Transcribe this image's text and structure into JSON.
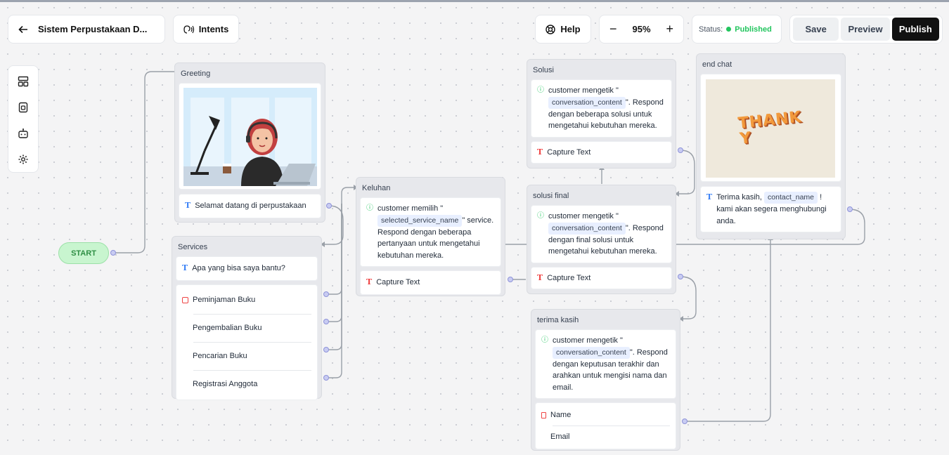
{
  "toolbar": {
    "back_icon": "arrow-left-icon",
    "project_title": "Sistem Perpustakaan D...",
    "intents_label": "Intents",
    "help_label": "Help",
    "zoom_out": "−",
    "zoom_level": "95%",
    "zoom_in": "+",
    "status_label": "Status:",
    "status_value": "Published",
    "save_label": "Save",
    "preview_label": "Preview",
    "publish_label": "Publish"
  },
  "sidebar": {
    "items": [
      {
        "icon": "layout-icon"
      },
      {
        "icon": "document-icon"
      },
      {
        "icon": "bot-icon"
      },
      {
        "icon": "gear-icon"
      }
    ]
  },
  "colors": {
    "status_green": "#22c55e",
    "publish_bg": "#111111",
    "wire": "#9aa0a8",
    "port": "#8e93d9"
  },
  "start": {
    "label": "START"
  },
  "nodes": {
    "greeting": {
      "title": "Greeting",
      "message": "Selamat datang di perpustakaan"
    },
    "services": {
      "title": "Services",
      "question": "Apa yang bisa saya bantu?",
      "options": [
        "Peminjaman Buku",
        "Pengembalian Buku",
        "Pencarian Buku",
        "Registrasi Anggota"
      ]
    },
    "keluhan": {
      "title": "Keluhan",
      "prompt_pre": "customer memilih \"",
      "variable": "selected_service_name",
      "prompt_post": "\" service.",
      "prompt_rest": "Respond dengan beberapa pertanyaan untuk mengetahui kebutuhan mereka.",
      "capture": "Capture Text"
    },
    "solusi": {
      "title": "Solusi",
      "prompt_pre": "customer mengetik \"",
      "variable": "conversation_content",
      "prompt_post": "\". Respond",
      "prompt_rest": "dengan beberapa solusi untuk mengetahui kebutuhan mereka.",
      "capture": "Capture Text"
    },
    "solusi_final": {
      "title": "solusi final",
      "prompt_pre": "customer mengetik \"",
      "variable": "conversation_content",
      "prompt_post": "\". Respond",
      "prompt_rest": "dengan final solusi untuk mengetahui kebutuhan mereka.",
      "capture": "Capture Text"
    },
    "terima_kasih": {
      "title": "terima kasih",
      "prompt_pre": "customer mengetik \"",
      "variable": "conversation_content",
      "prompt_post": "\". Respond",
      "prompt_rest": "dengan keputusan terakhir dan arahkan untuk mengisi nama dan email.",
      "fields": [
        "Name",
        "Email"
      ]
    },
    "end_chat": {
      "title": "end chat",
      "image_text": "THANK Y",
      "message_pre": "Terima kasih,",
      "variable": "contact_name",
      "message_post": "!",
      "message_rest": "kami akan segera menghubungi anda."
    }
  }
}
